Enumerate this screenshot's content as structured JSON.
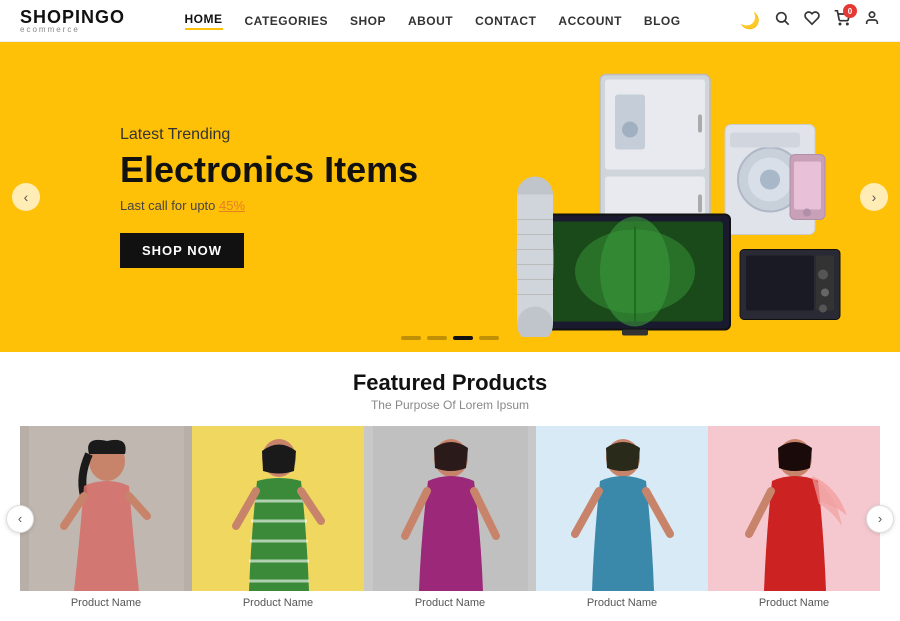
{
  "logo": {
    "main": "SHOPINGO",
    "sub": "eCommerce"
  },
  "nav": {
    "items": [
      {
        "label": "HOME",
        "active": true
      },
      {
        "label": "CATEGORIES",
        "active": false
      },
      {
        "label": "SHOP",
        "active": false
      },
      {
        "label": "ABOUT",
        "active": false
      },
      {
        "label": "CONTACT",
        "active": false
      },
      {
        "label": "ACCOUNT",
        "active": false
      },
      {
        "label": "BLOG",
        "active": false
      }
    ]
  },
  "header_icons": {
    "dark_mode": "🌙",
    "search": "🔍",
    "wishlist": "🤍",
    "cart": "🛒",
    "cart_count": "0",
    "account": "👤"
  },
  "hero": {
    "sub_label": "Latest Trending",
    "title": "Electronics Items",
    "offer_text": "Last call for upto 45%",
    "offer_percent": "45%",
    "cta_label": "SHOP NOW",
    "arrow_left": "‹",
    "arrow_right": "›",
    "dots": [
      {
        "active": false
      },
      {
        "active": false
      },
      {
        "active": true
      },
      {
        "active": false
      }
    ]
  },
  "featured": {
    "title": "Featured Products",
    "subtitle": "The Purpose Of Lorem Ipsum",
    "arrow_left": "‹",
    "arrow_right": "›",
    "products": [
      {
        "name": "Product Name",
        "bg": "#c8b8a2",
        "figure_color": "#b07050"
      },
      {
        "name": "Product Name",
        "bg": "#f5e6c8",
        "figure_color": "#3a8a3a"
      },
      {
        "name": "Product Name",
        "bg": "#c8c8c8",
        "figure_color": "#9b3070"
      },
      {
        "name": "Product Name",
        "bg": "#d8eaf5",
        "figure_color": "#3a8aaa"
      },
      {
        "name": "Product Name",
        "bg": "#f5c8d0",
        "figure_color": "#cc2222"
      }
    ]
  }
}
